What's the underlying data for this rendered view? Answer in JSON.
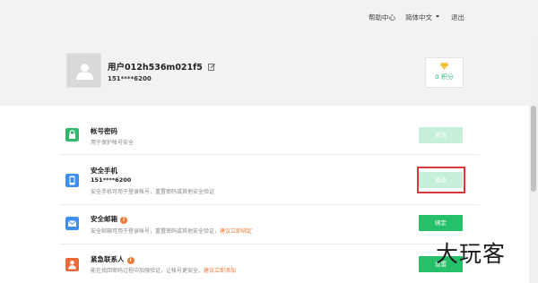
{
  "nav": {
    "help": "帮助中心",
    "language": "简体中文",
    "logout": "退出"
  },
  "profile": {
    "username": "用户012h536m021f5",
    "phone": "151****6200",
    "points": "0 积分"
  },
  "rows": [
    {
      "title": "帐号密码",
      "subtitle": "用于保护帐号安全",
      "button": "修改"
    },
    {
      "title": "安全手机",
      "phone": "151****6200",
      "subtitle": "安全手机可用于登录帐号，重置密码或其他安全验证",
      "button": "修改"
    },
    {
      "title": "安全邮箱",
      "subtitle": "安全邮箱可用于登录帐号，重置密码或其他安全验证，",
      "link": "建议立即绑定",
      "button": "绑定"
    },
    {
      "title": "紧急联系人",
      "subtitle": "能在找回密码过程中加强验证，让帐号更安全，",
      "link": "建议立即添加",
      "button": "设置"
    }
  ],
  "colors": {
    "green": "#26c06a",
    "light_green": "#c6efd9",
    "orange": "#ea7b35",
    "red_highlight": "#d93939"
  },
  "watermark": "大玩客"
}
